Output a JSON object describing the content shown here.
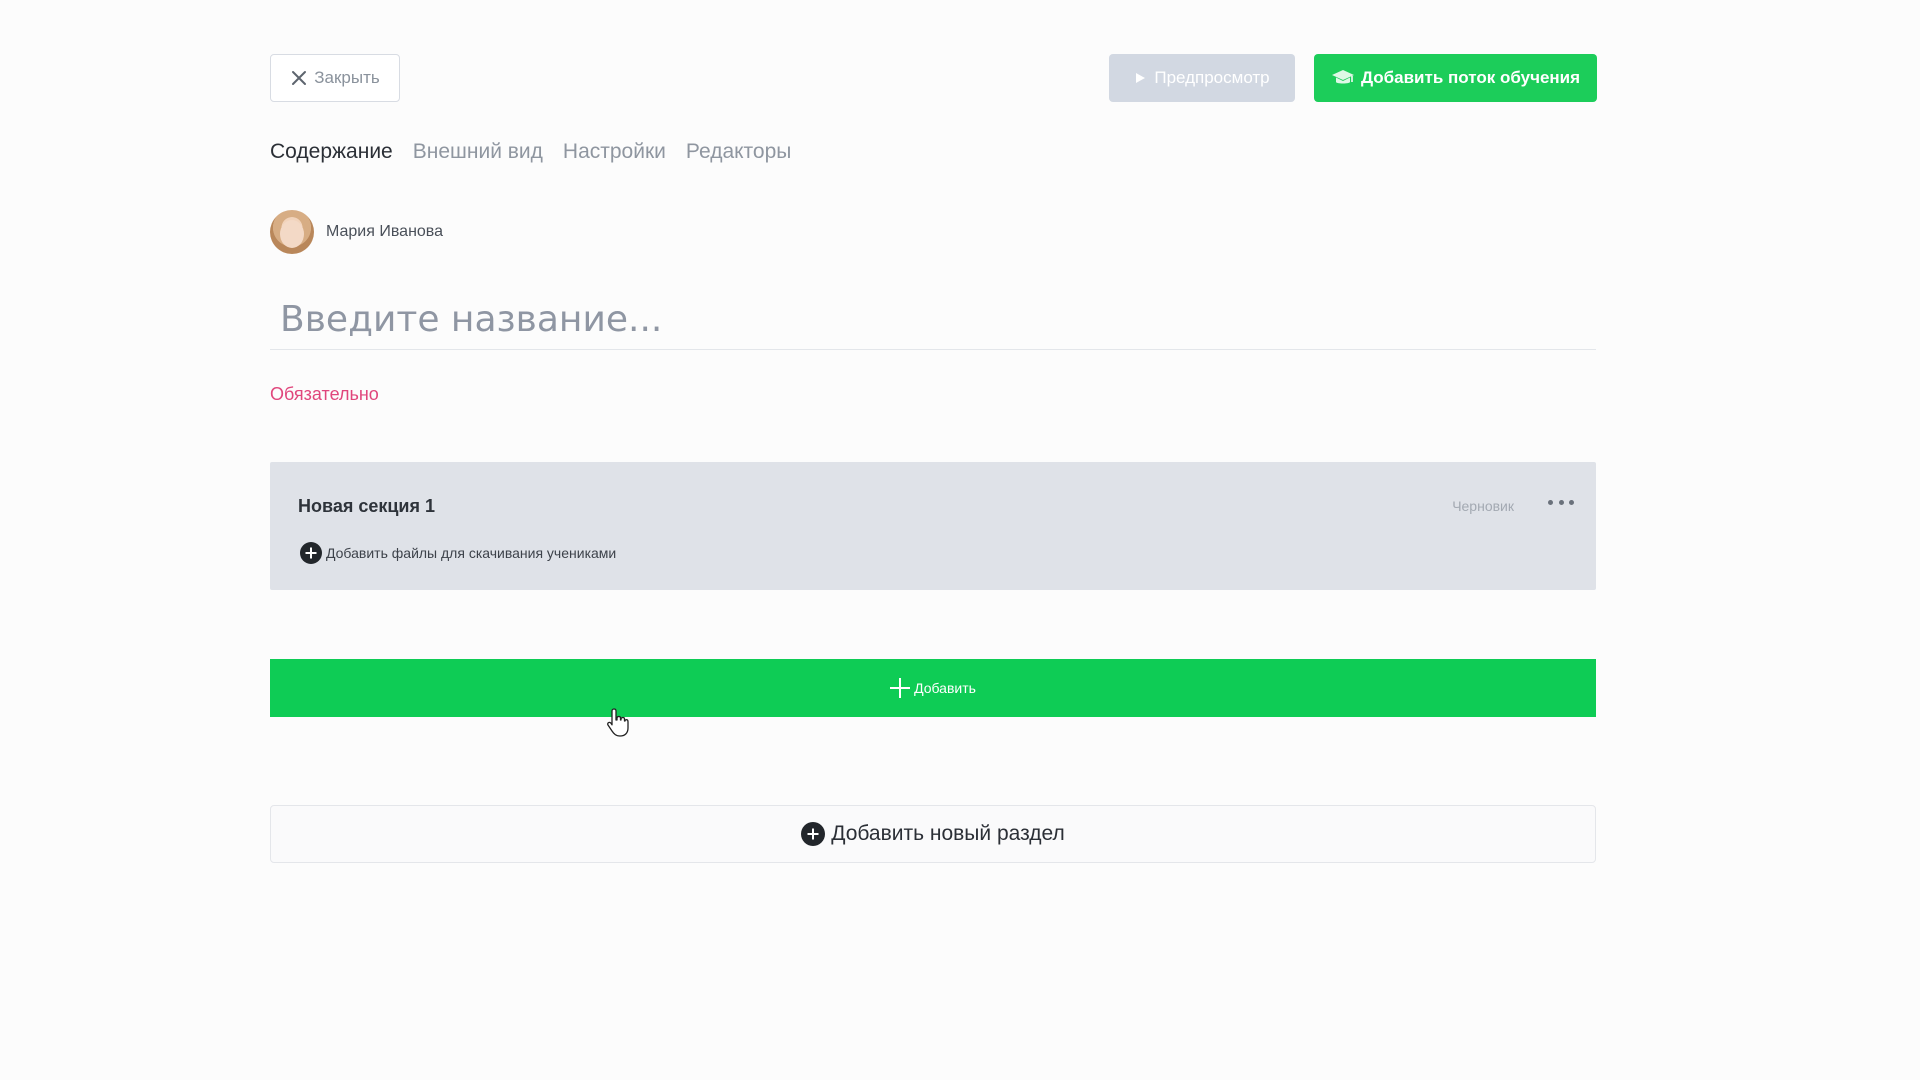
{
  "topbar": {
    "close_label": "Закрыть",
    "preview_label": "Предпросмотр",
    "add_stream_label": "Добавить поток обучения"
  },
  "tabs": [
    {
      "label": "Содержание",
      "active": true
    },
    {
      "label": "Внешний вид",
      "active": false
    },
    {
      "label": "Настройки",
      "active": false
    },
    {
      "label": "Редакторы",
      "active": false
    }
  ],
  "author": {
    "name": "Мария Иванова"
  },
  "title_field": {
    "placeholder": "Введите название...",
    "value": "",
    "required_hint": "Обязательно"
  },
  "section": {
    "title": "Новая секция 1",
    "status": "Черновик",
    "add_files_label": "Добавить файлы для скачивания учениками"
  },
  "add_button": {
    "label": "Добавить"
  },
  "add_section": {
    "label": "Добавить новый раздел"
  },
  "colors": {
    "accent_green": "#1ccd5a",
    "preview_disabled": "#d2d8e2",
    "required_pink": "#e0467c",
    "section_bg": "#dfe2e8"
  }
}
